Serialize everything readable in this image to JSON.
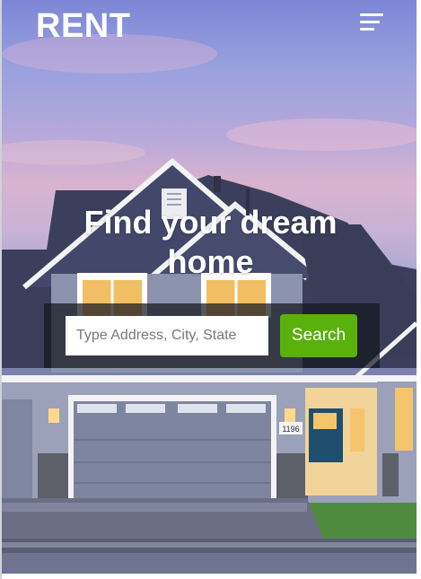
{
  "header": {
    "logo_text": "RENT",
    "menu_icon": "hamburger-menu-icon"
  },
  "hero": {
    "headline_line1": "Find your dream",
    "headline_line2": "home"
  },
  "search": {
    "placeholder": "Type Address, City, State",
    "value": "",
    "button_label": "Search"
  },
  "house": {
    "address_number": "1196"
  },
  "colors": {
    "accent_green": "#5bb10c",
    "roof": "#3c4161",
    "siding": "#8c95ad",
    "trim": "#ffffff",
    "door": "#1f4e6e",
    "window_glow": "#f6c46a"
  }
}
